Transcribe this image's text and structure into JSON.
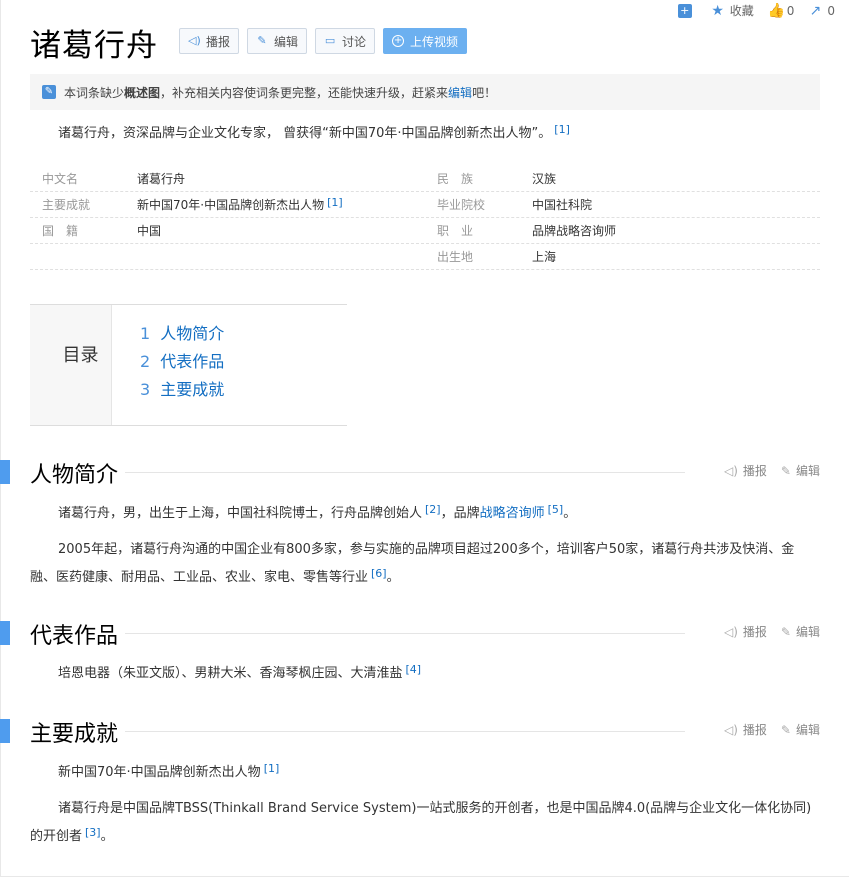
{
  "top_tools": {
    "add_icon": "plus-square-icon",
    "favorite_label": "收藏",
    "like_count": "0",
    "share_count": "0"
  },
  "title": "诸葛行舟",
  "buttons": {
    "play": "播报",
    "edit": "编辑",
    "discuss": "讨论",
    "upload": "上传视频"
  },
  "notice": {
    "pre": "本词条缺少",
    "bold": "概述图",
    "mid": "，补充相关内容使词条更完整，还能快速升级，赶紧来",
    "link": "编辑",
    "post": "吧！"
  },
  "summary": {
    "text": "诸葛行舟，资深品牌与企业文化专家， 曾获得“新中国70年·中国品牌创新杰出人物”。",
    "ref": "[1]"
  },
  "info": [
    {
      "left": {
        "k": "中文名",
        "v": "诸葛行舟",
        "ref": ""
      },
      "right": {
        "k": "民　族",
        "v": "汉族"
      }
    },
    {
      "left": {
        "k": "主要成就",
        "v": "新中国70年·中国品牌创新杰出人物",
        "ref": "[1]"
      },
      "right": {
        "k": "毕业院校",
        "v": "中国社科院"
      }
    },
    {
      "left": {
        "k": "国　籍",
        "v": "中国",
        "ref": ""
      },
      "right": {
        "k": "职　业",
        "v": "品牌战略咨询师"
      }
    },
    {
      "left": {
        "k": "",
        "v": "",
        "ref": ""
      },
      "right": {
        "k": "出生地",
        "v": "上海"
      }
    }
  ],
  "toc": {
    "title": "目录",
    "items": [
      {
        "num": "1",
        "label": "人物简介"
      },
      {
        "num": "2",
        "label": "代表作品"
      },
      {
        "num": "3",
        "label": "主要成就"
      }
    ]
  },
  "section_tools": {
    "play": "播报",
    "edit": "编辑"
  },
  "sections": {
    "intro": {
      "title": "人物简介",
      "p1_a": "诸葛行舟，男，出生于上海，中国社科院博士，行舟品牌创始人",
      "p1_ref1": "[2]",
      "p1_b": "，品牌",
      "p1_link": "战略咨询师",
      "p1_ref2": "[5]",
      "p1_c": "。",
      "p2": "2005年起，诸葛行舟沟通的中国企业有800多家，参与实施的品牌项目超过200多个，培训客户50家，诸葛行舟共涉及快消、金融、医药健康、耐用品、工业品、农业、家电、零售等行业",
      "p2_ref": "[6]",
      "p2_end": "。"
    },
    "works": {
      "title": "代表作品",
      "p1": "培恩电器（朱亚文版）、男耕大米、香海琴枫庄园、大清淮盐",
      "p1_ref": "[4]"
    },
    "achievements": {
      "title": "主要成就",
      "p1": "新中国70年·中国品牌创新杰出人物",
      "p1_ref": "[1]",
      "p2": "诸葛行舟是中国品牌TBSS(Thinkall Brand Service System)一站式服务的开创者，也是中国品牌4.0(品牌与企业文化一体化协同)的开创者",
      "p2_ref": "[3]",
      "p2_end": "。"
    }
  }
}
